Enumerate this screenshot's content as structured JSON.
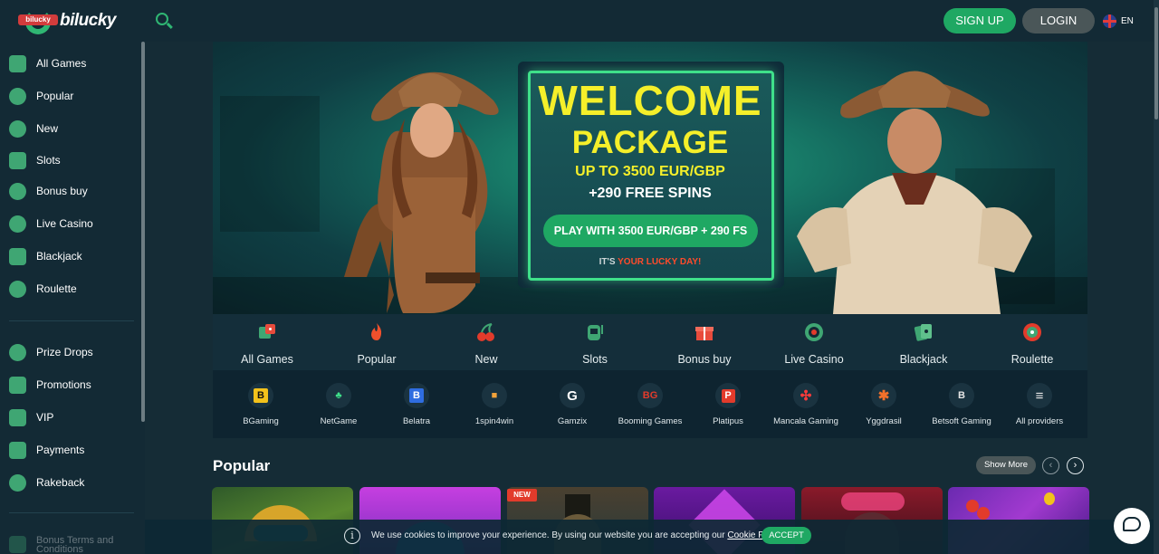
{
  "brand": {
    "logo_text": "bilucky",
    "logo_ribbon": "bilucky"
  },
  "header": {
    "signup": "SIGN UP",
    "login": "LOGIN",
    "lang": "EN"
  },
  "sidebar": {
    "items": [
      {
        "label": "All Games",
        "icon": "dice-icon"
      },
      {
        "label": "Popular",
        "icon": "flame-icon"
      },
      {
        "label": "New",
        "icon": "cherry-icon"
      },
      {
        "label": "Slots",
        "icon": "slot-machine-icon"
      },
      {
        "label": "Bonus buy",
        "icon": "money-bag-icon"
      },
      {
        "label": "Live Casino",
        "icon": "poker-chip-icon"
      },
      {
        "label": "Blackjack",
        "icon": "cards-icon"
      },
      {
        "label": "Roulette",
        "icon": "roulette-icon"
      }
    ],
    "extra": [
      {
        "label": "Prize Drops",
        "icon": "medal-icon"
      },
      {
        "label": "Promotions",
        "icon": "gift-icon"
      },
      {
        "label": "VIP",
        "icon": "diamond-icon"
      },
      {
        "label": "Payments",
        "icon": "wallet-icon"
      },
      {
        "label": "Rakeback",
        "icon": "coins-icon"
      },
      {
        "label": "Bonus Terms and Conditions",
        "icon": "document-icon"
      }
    ]
  },
  "hero": {
    "welcome": "WELCOME",
    "package": "PACKAGE",
    "upto": "UP TO 3500 EUR/GBP",
    "spins": "+290 FREE SPINS",
    "cta": "PLAY WITH 3500 EUR/GBP + 290 FS",
    "lucky_prefix": "IT'S ",
    "lucky_highlight": "YOUR LUCKY DAY!"
  },
  "categories": [
    {
      "label": "All Games",
      "icon": "dice-icon"
    },
    {
      "label": "Popular",
      "icon": "flame-icon"
    },
    {
      "label": "New",
      "icon": "cherry-icon"
    },
    {
      "label": "Slots",
      "icon": "slot-machine-icon"
    },
    {
      "label": "Bonus buy",
      "icon": "gift-icon"
    },
    {
      "label": "Live Casino",
      "icon": "poker-chip-icon"
    },
    {
      "label": "Blackjack",
      "icon": "cards-icon"
    },
    {
      "label": "Roulette",
      "icon": "roulette-icon"
    }
  ],
  "providers": [
    {
      "label": "BGaming",
      "mark": "B"
    },
    {
      "label": "NetGame",
      "mark": "♣"
    },
    {
      "label": "Belatra",
      "mark": "B"
    },
    {
      "label": "1spin4win",
      "mark": "■"
    },
    {
      "label": "Gamzix",
      "mark": "G"
    },
    {
      "label": "Booming Games",
      "mark": "BG"
    },
    {
      "label": "Platipus",
      "mark": "P"
    },
    {
      "label": "Mancala Gaming",
      "mark": "✣"
    },
    {
      "label": "Yggdrasil",
      "mark": "✱"
    },
    {
      "label": "Betsoft Gaming",
      "mark": "B"
    },
    {
      "label": "All providers",
      "mark": "≡"
    }
  ],
  "popular": {
    "title": "Popular",
    "show_more": "Show More",
    "new_badge": "NEW",
    "prev": "‹",
    "next": "›"
  },
  "cookie": {
    "text": "We use cookies to improve your experience. By using our website you are accepting our ",
    "link": "Cookie Policy.",
    "accept": "ACCEPT",
    "info": "i"
  },
  "colors": {
    "accent": "#1fa863",
    "banner_yellow": "#f5ef2a",
    "lucky_red": "#ff4b2b"
  }
}
